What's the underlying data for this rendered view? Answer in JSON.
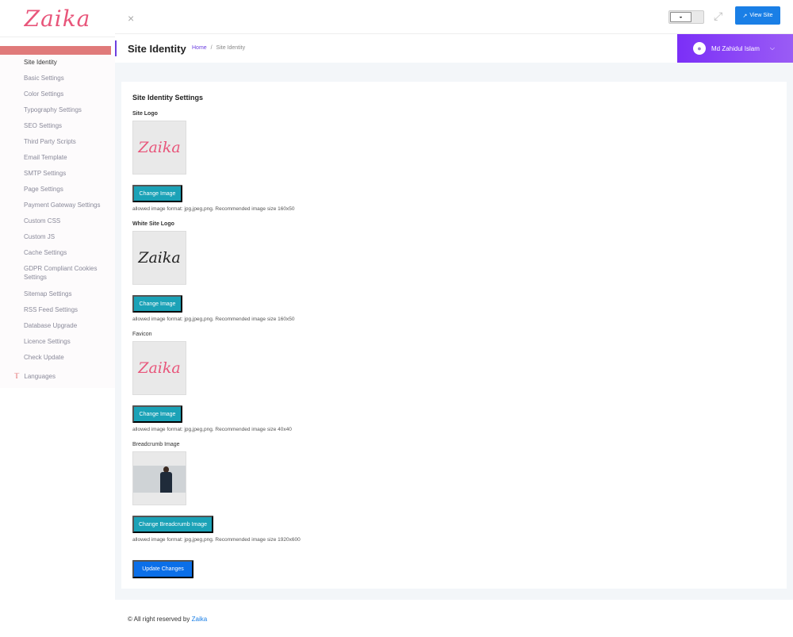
{
  "brand": {
    "logo_text": "Zaika"
  },
  "sidebar": {
    "items": [
      {
        "label": "Site Identity",
        "active": true
      },
      {
        "label": "Basic Settings"
      },
      {
        "label": "Color Settings"
      },
      {
        "label": "Typography Settings"
      },
      {
        "label": "SEO Settings"
      },
      {
        "label": "Third Party Scripts"
      },
      {
        "label": "Email Template"
      },
      {
        "label": "SMTP Settings"
      },
      {
        "label": "Page Settings"
      },
      {
        "label": "Payment Gateway Settings"
      },
      {
        "label": "Custom CSS"
      },
      {
        "label": "Custom JS"
      },
      {
        "label": "Cache Settings"
      },
      {
        "label": "GDPR Compliant Cookies Settings"
      },
      {
        "label": "Sitemap Settings"
      },
      {
        "label": "RSS Feed Settings"
      },
      {
        "label": "Database Upgrade"
      },
      {
        "label": "Licence Settings"
      },
      {
        "label": "Check Update"
      }
    ],
    "languages_label": "Languages"
  },
  "topbar": {
    "close_icon": "×",
    "view_site_label": "View Site"
  },
  "header": {
    "title": "Site Identity",
    "breadcrumb_home": "Home",
    "breadcrumb_sep": "/",
    "breadcrumb_current": "Site Identity",
    "user_name": "Md Zahidul Islam"
  },
  "form": {
    "title": "Site Identity Settings",
    "site_logo_label": "Site Logo",
    "white_logo_label": "White Site Logo",
    "favicon_label": "Favicon",
    "breadcrumb_label": "Breadcrumb Image",
    "change_image_label": "Change Image",
    "change_breadcrumb_label": "Change Breadcrumb Image",
    "hint_logo": "allowed image format: jpg,jpeg,png. Recommended image size 160x50",
    "hint_white_logo": "allowed image format: jpg,jpeg,png. Recommended image size 160x50",
    "hint_favicon": "allowed image format: jpg,jpeg,png. Recommended image size 40x40",
    "hint_breadcrumb": "allowed image format: jpg,jpeg,png. Recommended image size 1920x600",
    "update_label": "Update Changes"
  },
  "footer": {
    "text": "© All right reserved by",
    "brand": "Zaika"
  },
  "colors": {
    "accent_purple": "#7b2ff7",
    "primary_blue": "#0b6fe8",
    "teal": "#1ba2b7",
    "logo_pink": "#e8557a"
  }
}
